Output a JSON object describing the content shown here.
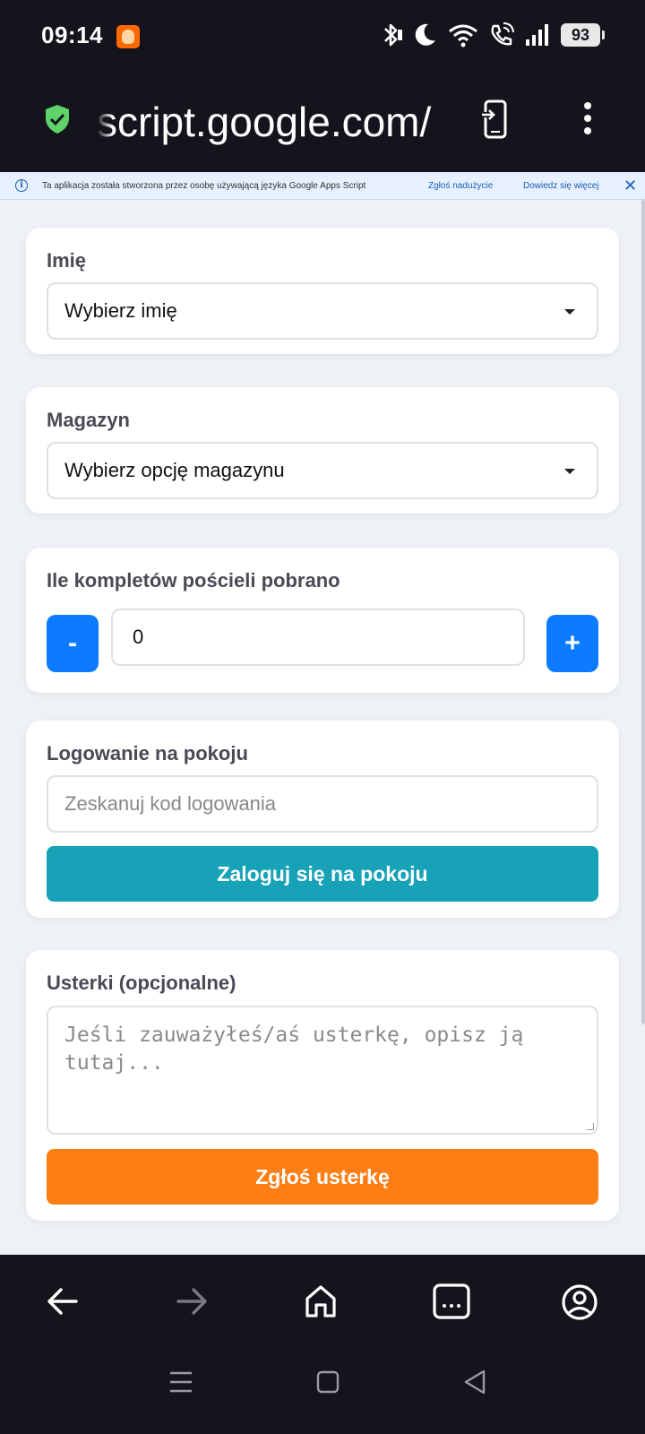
{
  "status_bar": {
    "time": "09:14",
    "battery": "93",
    "icons": [
      "bluetooth-icon",
      "moon-icon",
      "wifi-icon",
      "wifi-call-icon",
      "signal-icon",
      "battery-icon"
    ]
  },
  "browser": {
    "url": "script.google.com/",
    "icons": [
      "shield-icon",
      "mirror-device-icon",
      "more-vert-icon"
    ]
  },
  "gas_banner": {
    "message": "Ta aplikacja została stworzona przez osobę używającą języka Google Apps Script",
    "report_link": "Zgłoś nadużycie",
    "learn_more_link": "Dowiedz się więcej",
    "close": "✕"
  },
  "form": {
    "name": {
      "label": "Imię",
      "selected": "Wybierz imię"
    },
    "warehouse": {
      "label": "Magazyn",
      "selected": "Wybierz opcję magazynu"
    },
    "bedding": {
      "label": "Ile kompletów pościeli pobrano",
      "value": "0",
      "minus": "-",
      "plus": "+"
    },
    "room_login": {
      "label": "Logowanie na pokoju",
      "placeholder": "Zeskanuj kod logowania",
      "button": "Zaloguj się na pokoju"
    },
    "defects": {
      "label": "Usterki (opcjonalne)",
      "placeholder": "Jeśli zauważyłeś/aś usterkę, opisz ją tutaj...",
      "button": "Zgłoś usterkę"
    }
  },
  "colors": {
    "primary_blue": "#0d7bff",
    "teal": "#17a2b8",
    "orange": "#fd7e14",
    "page_bg": "#eef1f6",
    "chrome_bg": "#14141c"
  }
}
